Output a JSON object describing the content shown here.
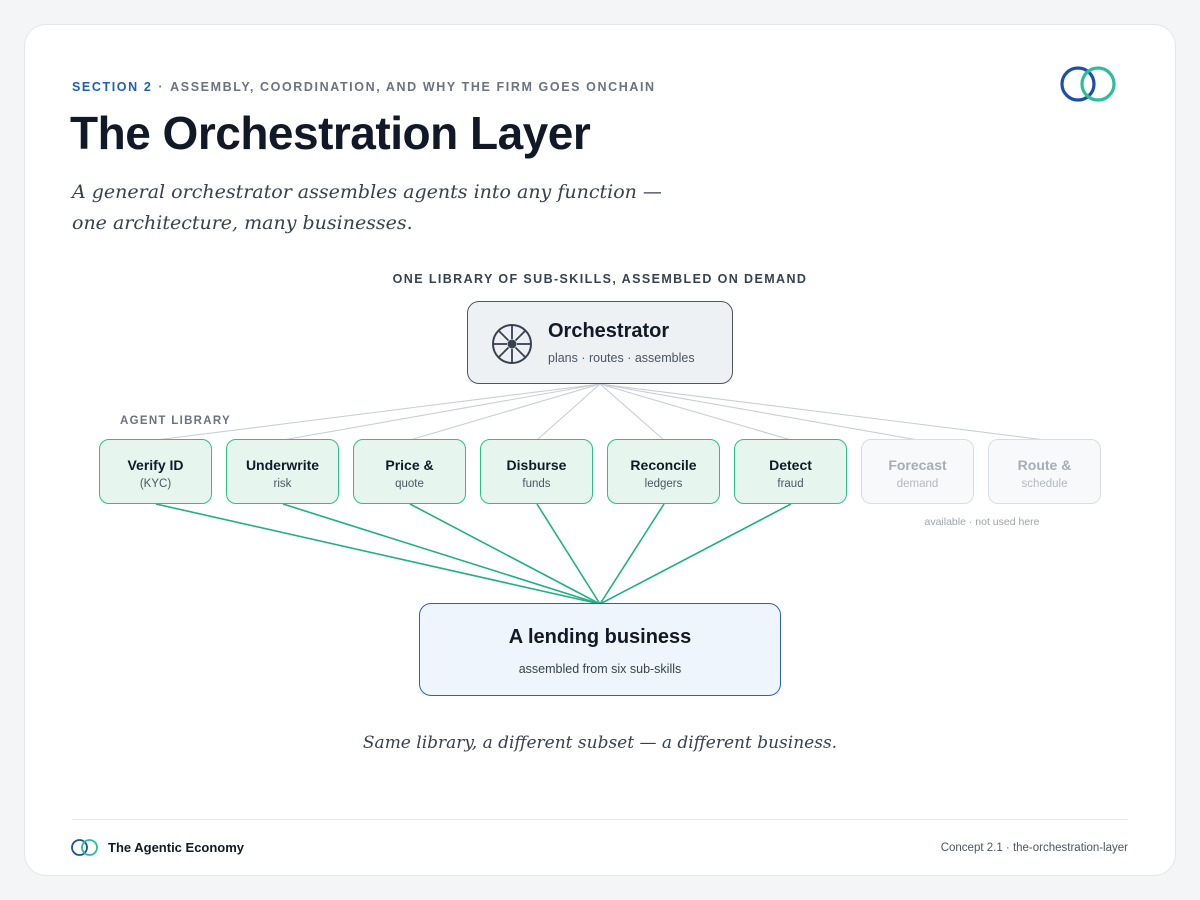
{
  "header": {
    "section_label": "SECTION 2",
    "section_separator": "·",
    "section_topic": "ASSEMBLY, COORDINATION, AND WHY THE FIRM GOES ONCHAIN",
    "title": "The Orchestration Layer",
    "subtitle": "A general orchestrator assembles agents into any function — one architecture, many businesses."
  },
  "diagram": {
    "heading": "ONE LIBRARY OF SUB-SKILLS, ASSEMBLED ON DEMAND",
    "orchestrator": {
      "title": "Orchestrator",
      "subtitle": "plans · routes · assembles",
      "icon": "wheel-icon"
    },
    "library_label": "AGENT LIBRARY",
    "skills": [
      {
        "name": "Verify ID",
        "sub": "(KYC)",
        "used": true
      },
      {
        "name": "Underwrite",
        "sub": "risk",
        "used": true
      },
      {
        "name": "Price &",
        "sub": "quote",
        "used": true
      },
      {
        "name": "Disburse",
        "sub": "funds",
        "used": true
      },
      {
        "name": "Reconcile",
        "sub": "ledgers",
        "used": true
      },
      {
        "name": "Detect",
        "sub": "fraud",
        "used": true
      },
      {
        "name": "Forecast",
        "sub": "demand",
        "used": false
      },
      {
        "name": "Route &",
        "sub": "schedule",
        "used": false
      }
    ],
    "unused_note": "available · not used here",
    "business": {
      "title": "A lending business",
      "subtitle": "assembled from six sub-skills"
    },
    "caption": "Same library, a different subset — a different business."
  },
  "footer": {
    "brand": "The Agentic Economy",
    "reference": "Concept 2.1 · the-orchestration-layer"
  },
  "colors": {
    "accent_blue": "#1d5fb8",
    "accent_green": "#2ebd8b",
    "used_fill": "#e6f6ef",
    "unused_border": "#d9dde2",
    "business_border": "#2a63b5"
  }
}
